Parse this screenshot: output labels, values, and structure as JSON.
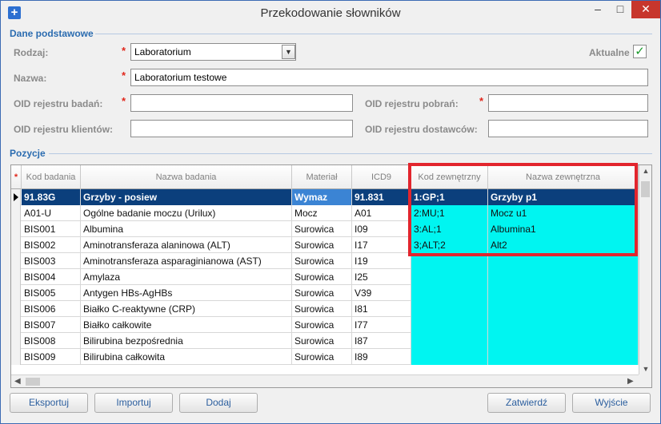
{
  "window": {
    "title": "Przekodowanie słowników",
    "minimize_glyph": "–",
    "maximize_glyph": "□",
    "close_glyph": "✕",
    "app_icon_glyph": "+"
  },
  "basic": {
    "section_title": "Dane podstawowe",
    "rodzaj_label": "Rodzaj:",
    "rodzaj_value": "Laboratorium",
    "aktualne_label": "Aktualne",
    "aktualne_checked": true,
    "nazwa_label": "Nazwa:",
    "nazwa_value": "Laboratorium testowe",
    "oid_badan_label": "OID rejestru badań:",
    "oid_badan_value": "",
    "oid_pobran_label": "OID rejestru pobrań:",
    "oid_pobran_value": "",
    "oid_klientow_label": "OID rejestru klientów:",
    "oid_klientow_value": "",
    "oid_dostawcow_label": "OID rejestru dostawców:",
    "oid_dostawcow_value": "",
    "required_mark": "*"
  },
  "positions": {
    "section_title": "Pozycje",
    "indicator_header": "*",
    "columns": [
      "Kod badania",
      "Nazwa badania",
      "Materiał",
      "ICD9",
      "Kod zewnętrzny",
      "Nazwa zewnętrzna"
    ],
    "rows": [
      [
        "91.83G",
        "Grzyby - posiew",
        "Wymaz",
        "91.831",
        "1:GP;1",
        "Grzyby p1"
      ],
      [
        "A01-U",
        "Ogólne badanie moczu (Urilux)",
        "Mocz",
        "A01",
        "2:MU;1",
        "Mocz u1"
      ],
      [
        "BIS001",
        "Albumina",
        "Surowica",
        "I09",
        "3:AL;1",
        "Albumina1"
      ],
      [
        "BIS002",
        "Aminotransferaza alaninowa (ALT)",
        "Surowica",
        "I17",
        "3;ALT;2",
        "Alt2"
      ],
      [
        "BIS003",
        "Aminotransferaza asparaginianowa (AST)",
        "Surowica",
        "I19",
        "",
        ""
      ],
      [
        "BIS004",
        "Amylaza",
        "Surowica",
        "I25",
        "",
        ""
      ],
      [
        "BIS005",
        "Antygen HBs-AgHBs",
        "Surowica",
        "V39",
        "",
        ""
      ],
      [
        "BIS006",
        "Białko C-reaktywne (CRP)",
        "Surowica",
        "I81",
        "",
        ""
      ],
      [
        "BIS007",
        "Białko całkowite",
        "Surowica",
        "I77",
        "",
        ""
      ],
      [
        "BIS008",
        "Bilirubina bezpośrednia",
        "Surowica",
        "I87",
        "",
        ""
      ],
      [
        "BIS009",
        "Bilirubina całkowita",
        "Surowica",
        "I89",
        "",
        ""
      ]
    ],
    "selected_row": 0
  },
  "buttons": {
    "export": "Eksportuj",
    "import": "Importuj",
    "add": "Dodaj",
    "confirm": "Zatwierdź",
    "exit": "Wyjście"
  },
  "colors": {
    "accent": "#2b6cb0",
    "selected_row": "#0b3f7c",
    "external_cells": "#00f5f1",
    "highlight_box": "#e2252d",
    "required": "#e0271c"
  }
}
